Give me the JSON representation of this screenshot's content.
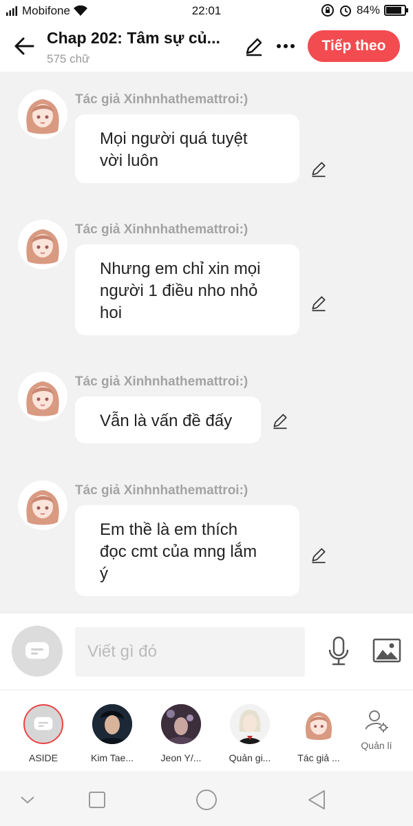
{
  "status_bar": {
    "carrier": "Mobifone",
    "time": "22:01",
    "battery": "84%",
    "battery_level": 0.84
  },
  "header": {
    "title": "Chap 202: Tâm sự củ...",
    "word_count": "575 chữ",
    "next_label": "Tiếp theo",
    "accent_color": "#f24b50"
  },
  "messages": [
    {
      "sender": "Tác giả Xinhnhathemattroi:)",
      "lines": [
        "Mọi người quá tuyệt",
        "vời luôn"
      ]
    },
    {
      "sender": "Tác giả Xinhnhathemattroi:)",
      "lines": [
        "Nhưng em chỉ xin mọi",
        "người 1 điều nho nhỏ",
        "hoi"
      ]
    },
    {
      "sender": "Tác giả Xinhnhathemattroi:)",
      "lines": [
        "Vẫn là vấn đề đấy"
      ]
    },
    {
      "sender": "Tác giả Xinhnhathemattroi:)",
      "lines": [
        "Em thề là em thích",
        "đọc cmt của mng lắm",
        "ý"
      ]
    }
  ],
  "composer": {
    "placeholder": "Viết gì đó"
  },
  "characters": [
    {
      "label": "ASIDE"
    },
    {
      "label": "Kim Tae..."
    },
    {
      "label": "Jeon Y/..."
    },
    {
      "label": "Quản gi..."
    },
    {
      "label": "Tác giả ..."
    },
    {
      "label": "Quản lí"
    }
  ],
  "icons": {
    "back": "arrow-left-icon",
    "edit": "pencil-icon",
    "more": "more-dots-icon",
    "mic": "microphone-icon",
    "image": "image-icon",
    "manage": "user-settings-icon"
  }
}
